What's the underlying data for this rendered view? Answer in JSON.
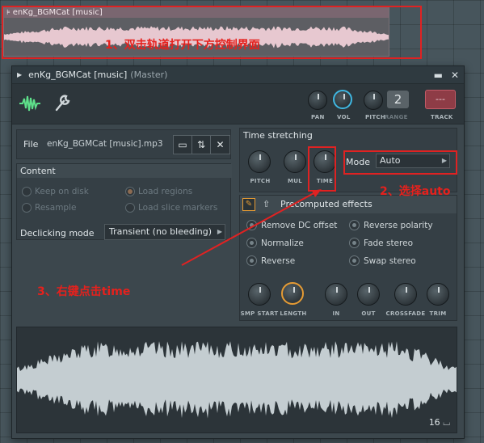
{
  "clip": {
    "name": "enKg_BGMCat [music]",
    "annotation": "1、双击轨道打开下方控制界面"
  },
  "window": {
    "title": "enKg_BGMCat [music]",
    "subtitle": "(Master)"
  },
  "toolbar": {
    "pan_label": "PAN",
    "vol_label": "VOL",
    "pitch_label": "PITCH",
    "range_label": "RANGE",
    "range_value": "2",
    "track_label": "TRACK",
    "track_value": "---"
  },
  "file": {
    "label": "File",
    "name": "enKg_BGMCat [music].mp3"
  },
  "content": {
    "title": "Content",
    "options": {
      "keep_on_disk": "Keep on disk",
      "load_regions": "Load regions",
      "resample": "Resample",
      "load_slice_markers": "Load slice markers"
    },
    "declicking_label": "Declicking mode",
    "declicking_value": "Transient (no bleeding)"
  },
  "time_stretching": {
    "title": "Time stretching",
    "pitch_label": "PITCH",
    "mul_label": "MUL",
    "time_label": "TIME",
    "mode_label": "Mode",
    "mode_value": "Auto"
  },
  "precomputed": {
    "title": "Precomputed effects",
    "options": {
      "remove_dc": "Remove DC offset",
      "reverse_polarity": "Reverse polarity",
      "normalize": "Normalize",
      "fade_stereo": "Fade stereo",
      "reverse": "Reverse",
      "swap_stereo": "Swap stereo"
    },
    "knobs": {
      "smp_start": "SMP START",
      "length": "LENGTH",
      "in": "IN",
      "out": "OUT",
      "crossfade": "CROSSFADE",
      "trim": "TRIM"
    }
  },
  "waveform": {
    "bit_depth": "16"
  },
  "annotations": {
    "step2": "2、选择auto",
    "step3": "3、右键点击time"
  },
  "colors": {
    "annotation_red": "#e02222",
    "accent_orange": "#e59b34",
    "accent_blue": "#3fb6e0",
    "track_red": "#8e3c46"
  }
}
